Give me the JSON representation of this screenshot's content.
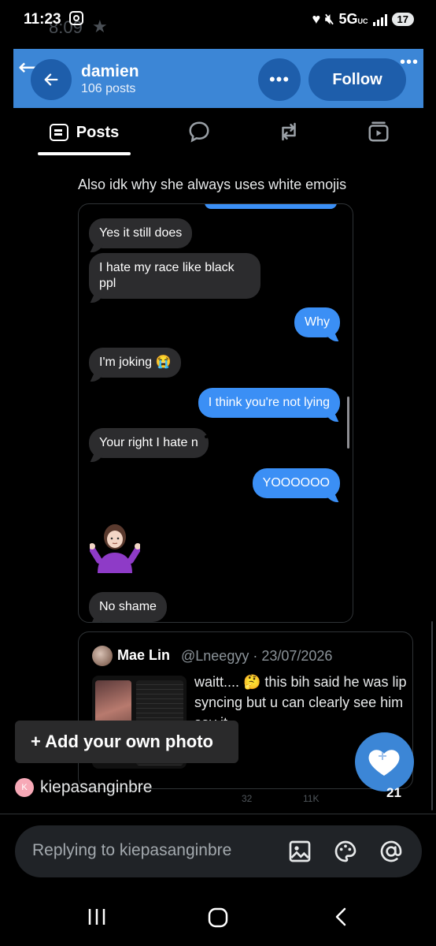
{
  "status_bar": {
    "time": "11:23",
    "ghost_time": "8:09",
    "network": "5G",
    "network_sub": "UC",
    "battery": "17"
  },
  "header": {
    "title": "damien",
    "subtitle": "106 posts",
    "more_label": "•••",
    "follow_label": "Follow",
    "color": "#3c86d6"
  },
  "tabs": {
    "posts_label": "Posts",
    "icons": [
      "posts-icon",
      "reply-bubble-icon",
      "repost-icon",
      "media-icon"
    ]
  },
  "post": {
    "text": "Also idk why she always uses white emojis",
    "messages": [
      {
        "side": "in",
        "text": "Yes it still does"
      },
      {
        "side": "in",
        "text": "I hate my race like black ppl"
      },
      {
        "side": "out",
        "text": "Why"
      },
      {
        "side": "in",
        "text": "I'm joking 😭"
      },
      {
        "side": "out",
        "text": "I think you're not lying"
      },
      {
        "side": "in",
        "text": "Your right I hate n"
      },
      {
        "side": "out",
        "text": "YOOOOOO"
      },
      {
        "side": "in",
        "text": "No shame"
      }
    ],
    "shrug_emoji": "person-shrugging-emoji"
  },
  "quote": {
    "name": "Mae Lin",
    "handle": "@Lneegyy · 23/07/2026",
    "text": "waitt.... 🤔 this bih said he was lip syncing but u can clearly see him say it"
  },
  "overlay": {
    "add_photo_label": "+ Add your own photo",
    "like_count": "21"
  },
  "reply": {
    "replier_initial": "K",
    "replier_name": "kiepasanginbre",
    "placeholder": "Replying to kiepasanginbre",
    "ghost_views": "11K",
    "ghost_likes": "32"
  }
}
